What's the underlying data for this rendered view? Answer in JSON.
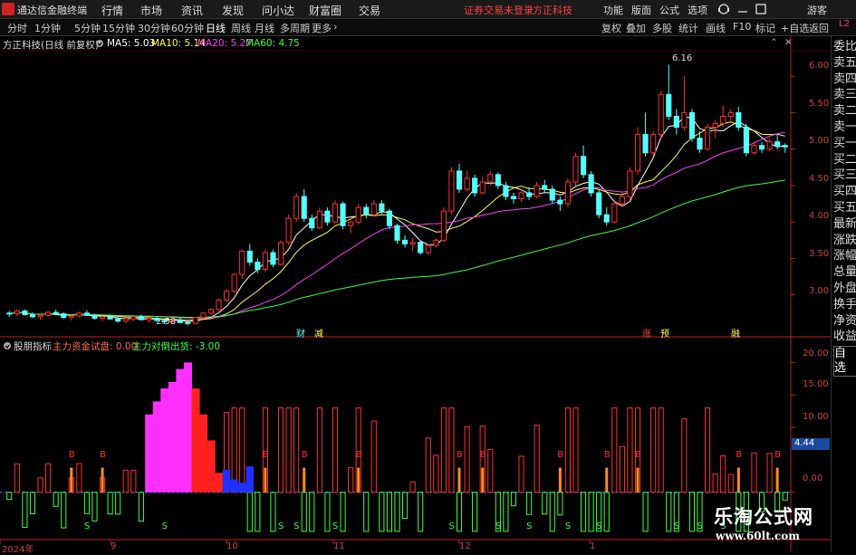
{
  "topbar": {
    "app_title": "通达信金融终端",
    "menu": [
      "行情",
      "市场",
      "资讯",
      "发现",
      "问小达",
      "财富圈",
      "交易"
    ],
    "notice": "证券交易未登录",
    "company": "方正科技",
    "right_menu": [
      "功能",
      "版面",
      "公式",
      "选项"
    ],
    "guest": "游客"
  },
  "periodbar": {
    "tabs": [
      "分时",
      "1分钟",
      "5分钟",
      "15分钟",
      "30分钟",
      "60分钟",
      "日线",
      "周线",
      "月线",
      "多周期",
      "更多"
    ],
    "active_tab": "日线",
    "tools": [
      "复权",
      "叠加",
      "多股",
      "统计",
      "画线",
      "F10",
      "标记",
      "+自选",
      "返回"
    ]
  },
  "info": {
    "stock": "方正科技(日线 前复权)",
    "ma5_label": "MA5: 5.03",
    "ma10_label": "MA10: 5.14",
    "ma20_label": "MA20: 5.27",
    "ma60_label": "MA60: 4.75"
  },
  "indicator": {
    "name": "股朋指标",
    "field1": "主力资金试盘: 0.00",
    "field2": "主力对倒出货: -3.00",
    "current_value": "4.44"
  },
  "right_panel": [
    "委比",
    "卖五",
    "卖四",
    "卖三",
    "卖二",
    "卖一",
    "买一",
    "买二",
    "买三",
    "买四",
    "买五",
    "最新",
    "涨跌",
    "涨幅",
    "总量",
    "外盘",
    "换手",
    "净资",
    "收益",
    "自选"
  ],
  "price_axis": [
    "6.00",
    "5.50",
    "5.00",
    "4.50",
    "4.00",
    "3.50",
    "3.00"
  ],
  "ind_axis": [
    "20.00",
    "15.00",
    "10.00",
    "0.00"
  ],
  "x_axis": [
    "2024年",
    "9",
    "10",
    "11",
    "12",
    "1"
  ],
  "annotations": {
    "high": "6.16",
    "low": "2.58",
    "events": [
      "财",
      "减",
      "涨",
      "预",
      "融"
    ]
  },
  "watermark": {
    "line1": "乐淘公式网",
    "line2": "www.60lt.com"
  },
  "colors": {
    "up": "#ff3030",
    "down": "#54ffff",
    "ma5": "#ffffff",
    "ma10": "#ffff50",
    "ma20": "#ff40ff",
    "ma60": "#40ff40",
    "axis": "#c02020"
  },
  "chart_data": {
    "type": "candlestick",
    "x": [
      "2024年",
      "9",
      "10",
      "11",
      "12",
      "1"
    ],
    "ohlc": [
      [
        2.75,
        2.78,
        2.7,
        2.74
      ],
      [
        2.74,
        2.8,
        2.71,
        2.78
      ],
      [
        2.78,
        2.8,
        2.72,
        2.73
      ],
      [
        2.73,
        2.76,
        2.68,
        2.7
      ],
      [
        2.7,
        2.74,
        2.66,
        2.72
      ],
      [
        2.72,
        2.78,
        2.7,
        2.76
      ],
      [
        2.76,
        2.8,
        2.72,
        2.74
      ],
      [
        2.74,
        2.76,
        2.67,
        2.69
      ],
      [
        2.69,
        2.73,
        2.65,
        2.71
      ],
      [
        2.71,
        2.77,
        2.69,
        2.75
      ],
      [
        2.75,
        2.79,
        2.71,
        2.72
      ],
      [
        2.72,
        2.74,
        2.66,
        2.68
      ],
      [
        2.68,
        2.72,
        2.64,
        2.7
      ],
      [
        2.7,
        2.73,
        2.66,
        2.67
      ],
      [
        2.67,
        2.7,
        2.62,
        2.64
      ],
      [
        2.64,
        2.69,
        2.61,
        2.67
      ],
      [
        2.67,
        2.72,
        2.64,
        2.7
      ],
      [
        2.7,
        2.73,
        2.65,
        2.66
      ],
      [
        2.66,
        2.7,
        2.62,
        2.68
      ],
      [
        2.68,
        2.71,
        2.63,
        2.65
      ],
      [
        2.65,
        2.68,
        2.6,
        2.63
      ],
      [
        2.63,
        2.67,
        2.6,
        2.66
      ],
      [
        2.66,
        2.69,
        2.61,
        2.62
      ],
      [
        2.62,
        2.64,
        2.58,
        2.61
      ],
      [
        2.61,
        2.7,
        2.6,
        2.69
      ],
      [
        2.69,
        2.76,
        2.67,
        2.75
      ],
      [
        2.75,
        2.82,
        2.72,
        2.8
      ],
      [
        2.8,
        2.95,
        2.78,
        2.93
      ],
      [
        2.93,
        3.08,
        2.9,
        3.05
      ],
      [
        3.05,
        3.3,
        3.02,
        3.28
      ],
      [
        3.28,
        3.62,
        3.22,
        3.6
      ],
      [
        3.6,
        3.7,
        3.4,
        3.45
      ],
      [
        3.45,
        3.5,
        3.3,
        3.35
      ],
      [
        3.35,
        3.62,
        3.32,
        3.58
      ],
      [
        3.58,
        3.62,
        3.38,
        3.42
      ],
      [
        3.42,
        3.75,
        3.4,
        3.72
      ],
      [
        3.72,
        4.1,
        3.68,
        4.05
      ],
      [
        4.05,
        4.4,
        4.0,
        4.35
      ],
      [
        4.35,
        4.45,
        4.0,
        4.05
      ],
      [
        4.05,
        4.1,
        3.88,
        3.92
      ],
      [
        3.92,
        4.2,
        3.9,
        4.15
      ],
      [
        4.15,
        4.2,
        3.95,
        4.0
      ],
      [
        4.0,
        4.3,
        3.98,
        4.25
      ],
      [
        4.25,
        4.28,
        3.9,
        3.95
      ],
      [
        3.95,
        4.05,
        3.85,
        4.0
      ],
      [
        4.0,
        4.25,
        3.97,
        4.2
      ],
      [
        4.2,
        4.25,
        4.05,
        4.1
      ],
      [
        4.1,
        4.3,
        4.08,
        4.25
      ],
      [
        4.25,
        4.3,
        4.1,
        4.15
      ],
      [
        4.15,
        4.18,
        3.9,
        3.95
      ],
      [
        3.95,
        3.98,
        3.7,
        3.75
      ],
      [
        3.75,
        3.82,
        3.65,
        3.7
      ],
      [
        3.7,
        3.78,
        3.6,
        3.72
      ],
      [
        3.72,
        3.75,
        3.55,
        3.58
      ],
      [
        3.58,
        3.7,
        3.55,
        3.68
      ],
      [
        3.68,
        3.78,
        3.65,
        3.75
      ],
      [
        3.75,
        4.2,
        3.72,
        4.15
      ],
      [
        4.15,
        4.75,
        4.1,
        4.7
      ],
      [
        4.7,
        4.8,
        4.4,
        4.45
      ],
      [
        4.45,
        4.7,
        4.42,
        4.6
      ],
      [
        4.6,
        4.65,
        4.35,
        4.4
      ],
      [
        4.4,
        4.62,
        4.38,
        4.55
      ],
      [
        4.55,
        4.7,
        4.5,
        4.65
      ],
      [
        4.65,
        4.68,
        4.45,
        4.5
      ],
      [
        4.5,
        4.55,
        4.3,
        4.35
      ],
      [
        4.35,
        4.4,
        4.25,
        4.32
      ],
      [
        4.32,
        4.45,
        4.28,
        4.4
      ],
      [
        4.4,
        4.48,
        4.3,
        4.35
      ],
      [
        4.35,
        4.55,
        4.32,
        4.5
      ],
      [
        4.5,
        4.58,
        4.4,
        4.45
      ],
      [
        4.45,
        4.5,
        4.25,
        4.3
      ],
      [
        4.3,
        4.35,
        4.15,
        4.25
      ],
      [
        4.25,
        4.6,
        4.2,
        4.55
      ],
      [
        4.55,
        4.95,
        4.5,
        4.9
      ],
      [
        4.9,
        5.05,
        4.6,
        4.65
      ],
      [
        4.65,
        4.7,
        4.35,
        4.4
      ],
      [
        4.4,
        4.45,
        4.05,
        4.1
      ],
      [
        4.1,
        4.2,
        3.95,
        4.0
      ],
      [
        4.0,
        4.3,
        3.98,
        4.25
      ],
      [
        4.25,
        4.4,
        4.2,
        4.35
      ],
      [
        4.35,
        4.75,
        4.3,
        4.7
      ],
      [
        4.7,
        5.3,
        4.65,
        5.2
      ],
      [
        5.2,
        5.5,
        4.9,
        4.95
      ],
      [
        4.95,
        5.25,
        4.9,
        5.2
      ],
      [
        5.2,
        5.8,
        5.15,
        5.75
      ],
      [
        5.75,
        6.16,
        5.4,
        5.45
      ],
      [
        5.45,
        5.55,
        5.2,
        5.3
      ],
      [
        5.3,
        6.0,
        5.25,
        5.5
      ],
      [
        5.5,
        5.55,
        5.1,
        5.15
      ],
      [
        5.15,
        5.25,
        4.95,
        5.0
      ],
      [
        5.0,
        5.35,
        4.98,
        5.3
      ],
      [
        5.3,
        5.4,
        5.15,
        5.35
      ],
      [
        5.35,
        5.6,
        5.3,
        5.45
      ],
      [
        5.45,
        5.55,
        5.35,
        5.5
      ],
      [
        5.5,
        5.58,
        5.25,
        5.3
      ],
      [
        5.3,
        5.35,
        4.9,
        4.95
      ],
      [
        4.95,
        5.1,
        4.92,
        5.05
      ],
      [
        5.05,
        5.1,
        4.95,
        5.0
      ],
      [
        5.0,
        5.15,
        4.97,
        5.1
      ],
      [
        5.1,
        5.2,
        5.0,
        5.05
      ],
      [
        5.05,
        5.08,
        4.95,
        5.03
      ]
    ],
    "ma_labels": [
      "MA5: 5.03",
      "MA10: 5.14",
      "MA20: 5.27",
      "MA60: 4.75"
    ],
    "price_range": [
      2.45,
      6.35
    ],
    "indicator_range": [
      -7,
      22
    ],
    "indicator_series": [
      {
        "name": "主力资金试盘",
        "values": [
          0,
          0,
          0,
          0,
          0,
          0,
          0,
          0,
          0,
          0,
          0,
          0,
          0,
          0,
          0,
          0,
          0,
          0,
          12,
          14,
          16,
          17,
          19,
          20,
          16,
          12,
          8,
          3,
          0,
          0,
          0,
          0,
          0,
          0,
          0,
          0,
          0,
          0,
          0,
          0,
          0,
          0,
          0,
          0,
          0,
          0,
          0,
          0,
          0,
          0,
          0,
          0,
          0,
          0,
          0,
          0,
          0,
          0,
          0,
          0,
          0,
          0,
          0,
          0,
          0,
          0,
          0,
          0,
          0,
          0,
          0,
          0,
          0,
          0,
          0,
          0,
          0,
          0,
          0,
          0,
          0,
          0,
          0,
          0,
          0,
          0,
          0,
          0,
          0,
          0,
          0,
          0,
          0,
          0,
          0,
          0,
          0,
          0,
          0,
          0,
          0
        ]
      }
    ]
  }
}
